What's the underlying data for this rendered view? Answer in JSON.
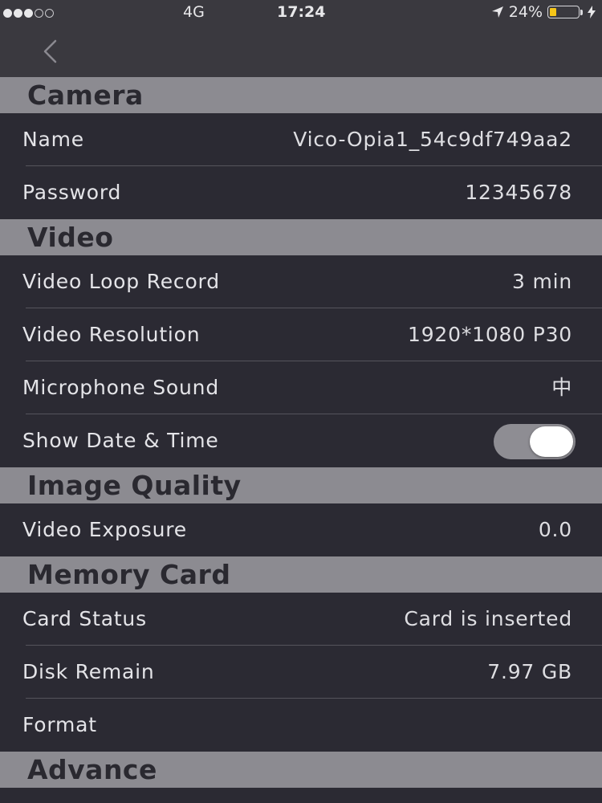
{
  "status_bar": {
    "signal_dots_filled": 3,
    "signal_dots_total": 5,
    "carrier": "4G",
    "time": "17:24",
    "battery_percent": "24%",
    "battery_level": 0.24,
    "battery_color": "#f5c518"
  },
  "navbar": {
    "back_icon": "chevron-left-icon"
  },
  "sections": [
    {
      "title": "Camera",
      "rows": [
        {
          "label": "Name",
          "value": "Vico-Opia1_54c9df749aa2"
        },
        {
          "label": "Password",
          "value": "12345678"
        }
      ]
    },
    {
      "title": "Video",
      "rows": [
        {
          "label": "Video Loop Record",
          "value": "3 min"
        },
        {
          "label": "Video Resolution",
          "value": "1920*1080 P30"
        },
        {
          "label": "Microphone Sound",
          "value": "中"
        },
        {
          "label": "Show Date & Time",
          "toggle": true
        }
      ]
    },
    {
      "title": "Image Quality",
      "rows": [
        {
          "label": "Video Exposure",
          "value": "0.0"
        }
      ]
    },
    {
      "title": "Memory Card",
      "rows": [
        {
          "label": "Card Status",
          "value": "Card is inserted"
        },
        {
          "label": "Disk Remain",
          "value": "7.97 GB"
        },
        {
          "label": "Format"
        }
      ]
    },
    {
      "title": "Advance",
      "rows": []
    }
  ]
}
